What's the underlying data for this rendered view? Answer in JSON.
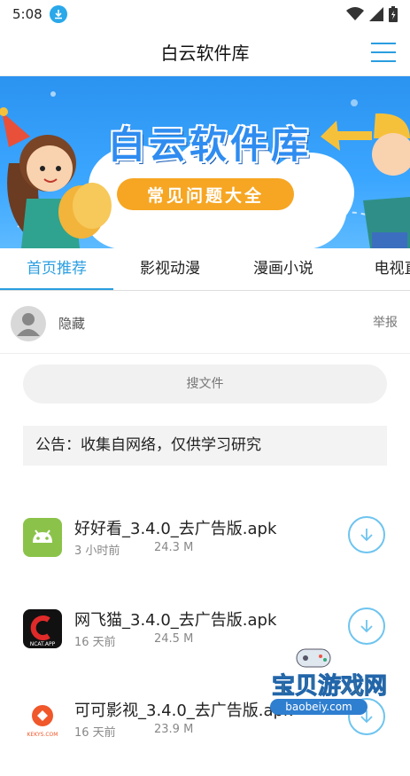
{
  "status": {
    "time": "5:08"
  },
  "header": {
    "title": "白云软件库"
  },
  "banner": {
    "title": "白云软件库",
    "subtitle": "常见问题大全"
  },
  "tabs": [
    {
      "label": "首页推荐",
      "active": true
    },
    {
      "label": "影视动漫",
      "active": false
    },
    {
      "label": "漫画小说",
      "active": false
    },
    {
      "label": "电视直",
      "active": false
    }
  ],
  "user": {
    "name": "隐藏",
    "report_label": "举报"
  },
  "search": {
    "placeholder": "搜文件"
  },
  "notice": {
    "text": "公告：收集自网络，仅供学习研究"
  },
  "files": [
    {
      "name": "好好看_3.4.0_去广告版.apk",
      "time": "3 小时前",
      "size": "24.3 M",
      "icon": "android-icon"
    },
    {
      "name": "网飞猫_3.4.0_去广告版.apk",
      "time": "16 天前",
      "size": "24.5 M",
      "icon": "ncat-app-icon",
      "icon_label": "NCAT.APP"
    },
    {
      "name": "可可影视_3.4.0_去广告版.apk",
      "time": "16 天前",
      "size": "23.9 M",
      "icon": "kekys-icon",
      "icon_label": "KEKYS.COM"
    }
  ],
  "watermark": {
    "title": "宝贝游戏网",
    "url": "baobeiy.com"
  },
  "colors": {
    "accent": "#2a9ee0",
    "banner": "#3ba6ff",
    "pill": "#f6a623"
  }
}
